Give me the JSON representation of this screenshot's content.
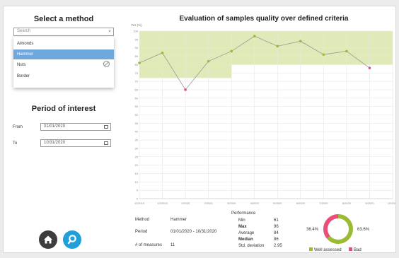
{
  "left": {
    "select_title": "Select a method",
    "search_placeholder": "Search",
    "options": [
      "Almonds",
      "Hammer",
      "Nuts",
      "Border"
    ],
    "selected_index": 1,
    "period_title": "Period of interest",
    "from_label": "From",
    "to_label": "To",
    "from_value": "01/01/2020",
    "to_value": "10/31/2020"
  },
  "chart_data": {
    "type": "line",
    "title": "Evaluation of samples quality over defined criteria",
    "ylabel": "Yes (%)",
    "ylim": [
      0,
      100
    ],
    "yticks": [
      0,
      5,
      10,
      15,
      20,
      25,
      30,
      35,
      40,
      45,
      50,
      55,
      60,
      65,
      70,
      75,
      80,
      85,
      90,
      95,
      100
    ],
    "values": [
      81,
      87,
      65,
      82,
      88,
      97,
      91,
      94,
      86,
      88,
      78
    ],
    "categories": [
      "11/2019",
      "12/2019",
      "1/2020",
      "2/2020",
      "3/2020",
      "4/2020",
      "5/2020",
      "6/2020",
      "7/2020",
      "8/2020",
      "9/2020",
      "10/2020"
    ],
    "well_assessed_color": "#9bbb33",
    "bad_color": "#e94f78",
    "band_color": "#dfeab8"
  },
  "summary": {
    "method_label": "Method",
    "method_value": "Hammer",
    "period_label": "Period",
    "period_value": "01/01/2020 - 10/31/2020",
    "measures_label": "# of measures",
    "measures_value": "11",
    "stats_title": "Performance",
    "stats": [
      {
        "label": "Min",
        "value": "61"
      },
      {
        "label": "Max",
        "value": "96"
      },
      {
        "label": "Average",
        "value": "84"
      },
      {
        "label": "Median",
        "value": "86"
      },
      {
        "label": "Std. deviation",
        "value": "2.95"
      }
    ],
    "donut": {
      "left_pct": "36.4%",
      "right_pct": "63.6%",
      "well_fraction": 0.636,
      "legend_well": "Well assessed",
      "legend_bad": "Bad"
    }
  },
  "buttons": {
    "home_icon": "home-icon",
    "search_icon": "search-icon",
    "home_color": "#3d3d3d",
    "search_color": "#1fa0d8"
  }
}
